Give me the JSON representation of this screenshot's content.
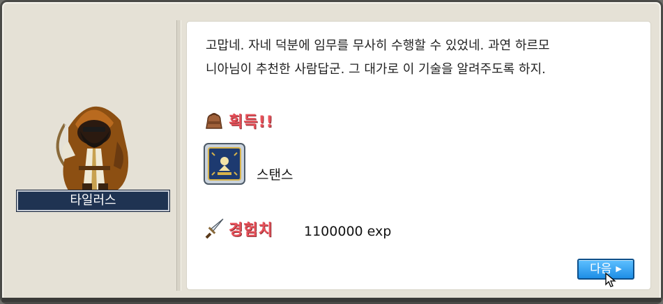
{
  "npc": {
    "name": "타일러스",
    "portrait_icon": "hooded-npc-portrait"
  },
  "dialog": {
    "message": "고맙네. 자네 덕분에 임무를 무사히 수행할 수 있었네. 과연 하르모\n니아님이 추천한 사람답군. 그 대가로 이 기술을 알려주도록 하지."
  },
  "rewards": {
    "obtain_heading": "획득!!",
    "obtain_icon": "bag-icon",
    "item": {
      "name": "스탠스",
      "icon": "skill-book-icon"
    },
    "exp_heading": "경험치",
    "exp_icon": "sword-icon",
    "exp_value": "1100000 exp"
  },
  "buttons": {
    "next_label": "다음",
    "next_icon": "play-arrow-icon"
  },
  "colors": {
    "heading_red": "#e8515a",
    "name_bar": "#1f3352",
    "next_button": "#1e8ee6"
  }
}
